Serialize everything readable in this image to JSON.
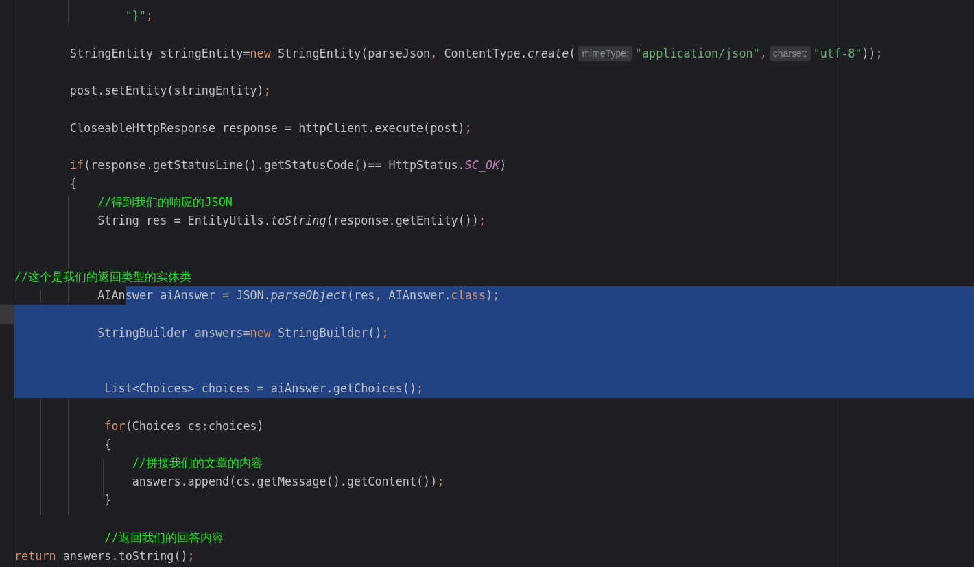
{
  "editor": {
    "lines": [
      {
        "selected": false,
        "current": false,
        "tokens": [
          {
            "kind": "string",
            "text": "                \"}\""
          },
          {
            "kind": "punct",
            "text": ";"
          }
        ]
      },
      {
        "selected": false,
        "current": false
      },
      {
        "selected": false,
        "current": false,
        "tokens": [
          {
            "kind": "plain",
            "text": "        StringEntity stringEntity="
          },
          {
            "kind": "keyword",
            "text": "new"
          },
          {
            "kind": "plain",
            "text": " StringEntity(parseJson"
          },
          {
            "kind": "punct",
            "text": ","
          },
          {
            "kind": "plain",
            "text": " ContentType."
          },
          {
            "kind": "italic",
            "text": "create"
          },
          {
            "kind": "plain",
            "text": "("
          },
          {
            "kind": "hint",
            "text": "mimeType:"
          },
          {
            "kind": "string",
            "text": "\"application/json\""
          },
          {
            "kind": "punct",
            "text": ","
          },
          {
            "kind": "hint",
            "text": "charset:"
          },
          {
            "kind": "string",
            "text": "\"utf-8\""
          },
          {
            "kind": "plain",
            "text": "))"
          },
          {
            "kind": "punct",
            "text": ";"
          }
        ]
      },
      {
        "selected": false,
        "current": false
      },
      {
        "selected": false,
        "current": false,
        "tokens": [
          {
            "kind": "plain",
            "text": "        post.setEntity(stringEntity)"
          },
          {
            "kind": "punct",
            "text": ";"
          }
        ]
      },
      {
        "selected": false,
        "current": false
      },
      {
        "selected": false,
        "current": false,
        "tokens": [
          {
            "kind": "plain",
            "text": "        CloseableHttpResponse response = httpClient.execute(post)"
          },
          {
            "kind": "punct",
            "text": ";"
          }
        ]
      },
      {
        "selected": false,
        "current": false
      },
      {
        "selected": false,
        "current": false,
        "tokens": [
          {
            "kind": "keyword",
            "text": "        if"
          },
          {
            "kind": "plain",
            "text": "(response.getStatusLine().getStatusCode()== HttpStatus."
          },
          {
            "kind": "constant",
            "text": "SC_OK"
          },
          {
            "kind": "plain",
            "text": ")"
          }
        ]
      },
      {
        "selected": false,
        "current": false,
        "tokens": [
          {
            "kind": "plain",
            "text": "        {"
          }
        ]
      },
      {
        "selected": false,
        "current": false,
        "tokens": [
          {
            "kind": "comment",
            "text": "            //得到我们的响应的JSON"
          }
        ]
      },
      {
        "selected": false,
        "current": false,
        "tokens": [
          {
            "kind": "plain",
            "text": "            String res = EntityUtils."
          },
          {
            "kind": "italic",
            "text": "toString"
          },
          {
            "kind": "plain",
            "text": "(response.getEntity())"
          },
          {
            "kind": "punct",
            "text": ";"
          }
        ]
      },
      {
        "selected": false,
        "current": false
      },
      {
        "selected": false,
        "current": false
      },
      {
        "selected": false,
        "current": false,
        "tokens": [
          {
            "kind": "comment",
            "text": "//这个是我们的返回类型的实体类"
          }
        ]
      },
      {
        "selected": false,
        "current": false,
        "tokens": [
          {
            "kind": "plain",
            "text": "            AIAn",
            "selected": false
          },
          {
            "kind": "plain",
            "text": "swer aiAnswer = JSON.",
            "selected": true
          },
          {
            "kind": "italic",
            "text": "parseObject",
            "selected": true
          },
          {
            "kind": "plain",
            "text": "(res",
            "selected": true
          },
          {
            "kind": "punct",
            "text": ",",
            "selected": true
          },
          {
            "kind": "plain",
            "text": " AIAnswer.",
            "selected": true
          },
          {
            "kind": "keyword",
            "text": "class",
            "selected": true
          },
          {
            "kind": "plain",
            "text": ")",
            "selected": true
          },
          {
            "kind": "punct",
            "text": ";",
            "selected": true
          }
        ]
      },
      {
        "selected": true,
        "current": true
      },
      {
        "selected": true,
        "current": false,
        "tokens": [
          {
            "kind": "plain",
            "text": "            StringBuilder answers="
          },
          {
            "kind": "keyword",
            "text": "new"
          },
          {
            "kind": "plain",
            "text": " StringBuilder()"
          },
          {
            "kind": "punct",
            "text": ";"
          }
        ]
      },
      {
        "selected": true,
        "current": false
      },
      {
        "selected": true,
        "current": false
      },
      {
        "selected": true,
        "current": false,
        "tokens": [
          {
            "kind": "plain",
            "text": "             List<Choices> choices = aiAnswer.getChoices()"
          },
          {
            "kind": "punct",
            "text": ";"
          }
        ]
      },
      {
        "selected": false,
        "current": false
      },
      {
        "selected": false,
        "current": false,
        "tokens": [
          {
            "kind": "keyword",
            "text": "             for"
          },
          {
            "kind": "plain",
            "text": "(Choices cs:choices)"
          }
        ]
      },
      {
        "selected": false,
        "current": false,
        "tokens": [
          {
            "kind": "plain",
            "text": "             {"
          }
        ]
      },
      {
        "selected": false,
        "current": false,
        "tokens": [
          {
            "kind": "comment",
            "text": "                 //拼接我们的文章的内容"
          }
        ]
      },
      {
        "selected": false,
        "current": false,
        "tokens": [
          {
            "kind": "plain",
            "text": "                 answers.append(cs.getMessage().getContent())"
          },
          {
            "kind": "punct",
            "text": ";"
          }
        ]
      },
      {
        "selected": false,
        "current": false,
        "tokens": [
          {
            "kind": "plain",
            "text": "             }"
          }
        ]
      },
      {
        "selected": false,
        "current": false
      },
      {
        "selected": false,
        "current": false,
        "tokens": [
          {
            "kind": "comment",
            "text": "             //返回我们的回答内容"
          }
        ]
      },
      {
        "selected": false,
        "current": false,
        "tokens": [
          {
            "kind": "keyword",
            "text": "return"
          },
          {
            "kind": "plain",
            "text": " answers.toString()"
          },
          {
            "kind": "punct",
            "text": ";"
          }
        ]
      }
    ]
  }
}
